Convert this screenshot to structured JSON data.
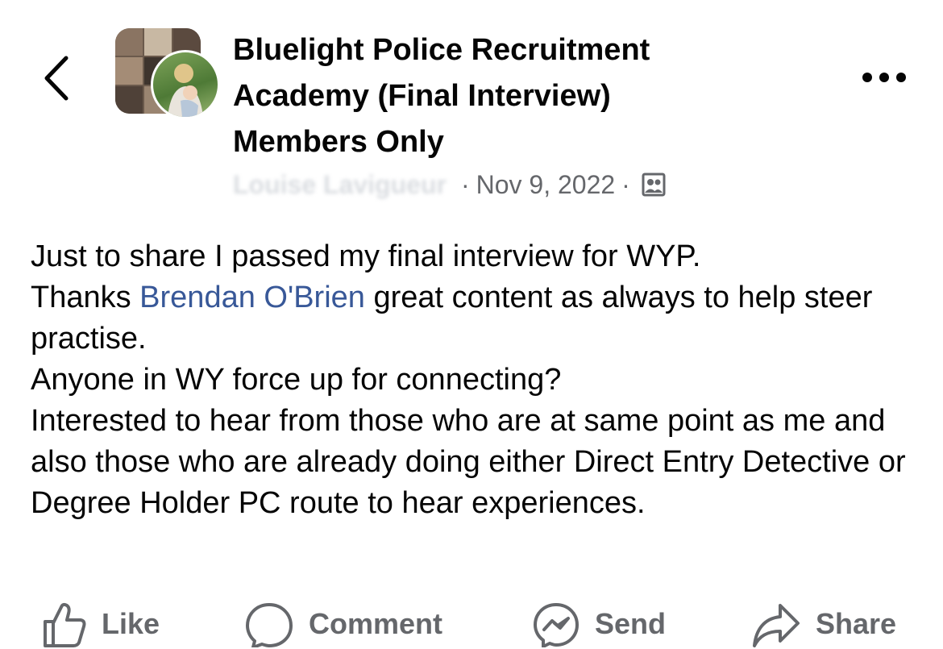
{
  "header": {
    "back_icon": "chevron-left-icon",
    "group_name_lines": [
      "Bluelight Police Recruitment",
      "Academy (Final Interview)",
      "Members Only"
    ],
    "author_name": "Louise Lavigueur",
    "separator": "·",
    "date": "Nov 9, 2022",
    "privacy_icon": "members-group-icon",
    "more_icon": "more-dots-icon"
  },
  "post": {
    "line1": "Just to share I passed my final interview for WYP.",
    "line2_before": "Thanks ",
    "mention": "Brendan O'Brien",
    "line2_after": " great content as always to help steer practise.",
    "line3": "Anyone in WY force up for connecting?",
    "line4": "Interested to hear from those who are at same point as me and also those who are already doing either Direct Entry Detective or Degree Holder PC route to hear experiences."
  },
  "actions": {
    "like_label": "Like",
    "comment_label": "Comment",
    "send_label": "Send",
    "share_label": "Share",
    "icons": [
      "thumbs-up-icon",
      "comment-bubble-icon",
      "messenger-icon",
      "share-arrow-icon"
    ]
  },
  "colors": {
    "text": "#050505",
    "secondary": "#65676b",
    "link": "#385898",
    "background": "#ffffff"
  }
}
